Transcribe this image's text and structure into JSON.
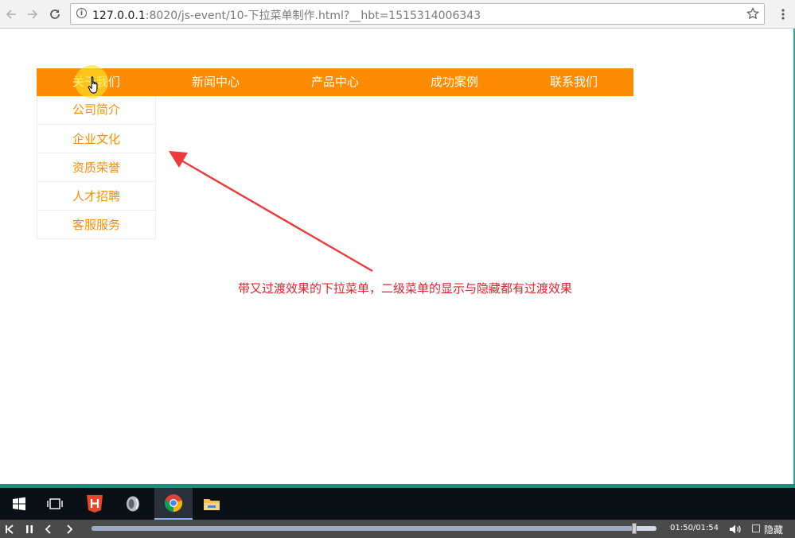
{
  "browser": {
    "url_host": "127.0.0.1",
    "url_rest": ":8020/js-event/10-下拉菜单制作.html?__hbt=1515314006343"
  },
  "nav": {
    "items": [
      {
        "label": "关于我们"
      },
      {
        "label": "新闻中心"
      },
      {
        "label": "产品中心"
      },
      {
        "label": "成功案例"
      },
      {
        "label": "联系我们"
      }
    ],
    "submenu": [
      {
        "label": "公司简介"
      },
      {
        "label": "企业文化"
      },
      {
        "label": "资质荣誉"
      },
      {
        "label": "人才招聘"
      },
      {
        "label": "客服服务"
      }
    ]
  },
  "annotation": "带又过渡效果的下拉菜单，二级菜单的显示与隐藏都有过渡效果",
  "player": {
    "time": "01:50/01:54",
    "progress": 0.96,
    "hide_label": "隐藏"
  },
  "colors": {
    "nav_bg": "#ff8c00",
    "nav_text": "#ffffff",
    "submenu_text": "#ff8c00",
    "annotation": "#e0222a"
  },
  "icons": {
    "back": "arrow-left-icon",
    "forward": "arrow-right-icon",
    "reload": "reload-icon",
    "info": "info-icon",
    "bookmark": "star-icon",
    "menu": "kebab-menu-icon",
    "taskbar": [
      "windows-start-icon",
      "task-view-icon",
      "html-editor-icon",
      "audio-app-icon",
      "chrome-icon",
      "file-explorer-icon"
    ],
    "player": [
      "skip-back-icon",
      "pause-icon",
      "prev-icon",
      "next-icon",
      "volume-icon"
    ]
  }
}
